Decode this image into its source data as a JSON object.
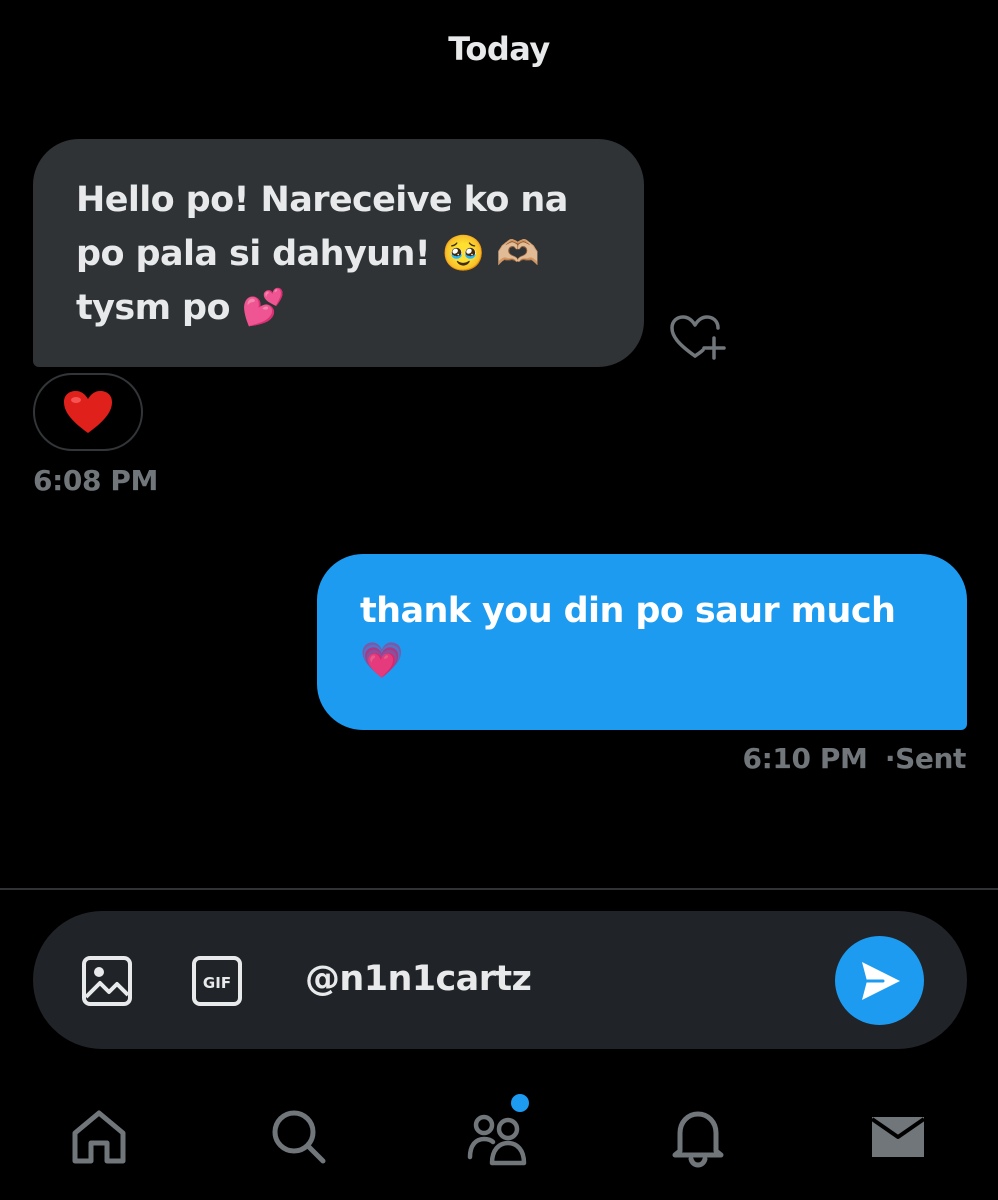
{
  "conversation": {
    "day_label": "Today",
    "incoming": {
      "line1": "Hello po! Nareceive ko na",
      "line2": "po pala si dahyun! 🥹 🫶🏼",
      "line3": "tysm po 💕",
      "reaction": "heart",
      "time": "6:08 PM"
    },
    "outgoing": {
      "line1": "thank you din po saur much",
      "line2": "💗",
      "time": "6:10 PM",
      "status": "·Sent"
    }
  },
  "composer": {
    "value": "@n1n1cartz",
    "media_icon": "image-icon",
    "gif_label": "GIF",
    "send_icon": "send-icon"
  },
  "nav": {
    "items": [
      "home-icon",
      "search-icon",
      "communities-icon",
      "notifications-icon",
      "messages-icon"
    ]
  },
  "colors": {
    "background": "#000000",
    "incoming_bubble": "#2f3336",
    "outgoing_bubble": "#1d9bf0",
    "muted_text": "#71767b",
    "composer_bg": "#202327",
    "accent": "#1d9bf0"
  }
}
